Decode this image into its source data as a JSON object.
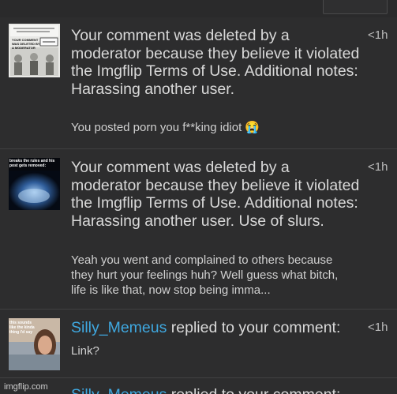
{
  "notifications": [
    {
      "message": "Your comment was deleted by a moderator because they believe it violated the Imgflip Terms of Use. Additional notes: Harassing another user.",
      "comment": "You posted porn you f**king idiot 😭",
      "time": "<1h",
      "thumb_text": "YOUR COMMENT WAS DELETED BY A MODERATOR"
    },
    {
      "message": "Your comment was deleted by a moderator because they believe it violated the Imgflip Terms of Use. Additional notes: Harassing another user. Use of slurs.",
      "comment": "Yeah you went and complained to others because they hurt your feelings huh? Well guess what bitch, life is like that, now stop being imma...",
      "time": "<1h",
      "thumb_text": "breaks the rules and his post gets removed:"
    },
    {
      "username": "Silly_Memeus",
      "action": " replied to your comment:",
      "comment": "Link?",
      "time": "<1h",
      "thumb_text": "this sounds like the kinda thing i'd say"
    }
  ],
  "peek": {
    "username": "Silly_Memeus",
    "action": " replied to your comment:"
  },
  "watermark": "imgflip.com",
  "colors": {
    "background": "#2d2d2e",
    "text": "#d9d9d9",
    "link": "#3fa8e0",
    "divider": "#414142"
  }
}
